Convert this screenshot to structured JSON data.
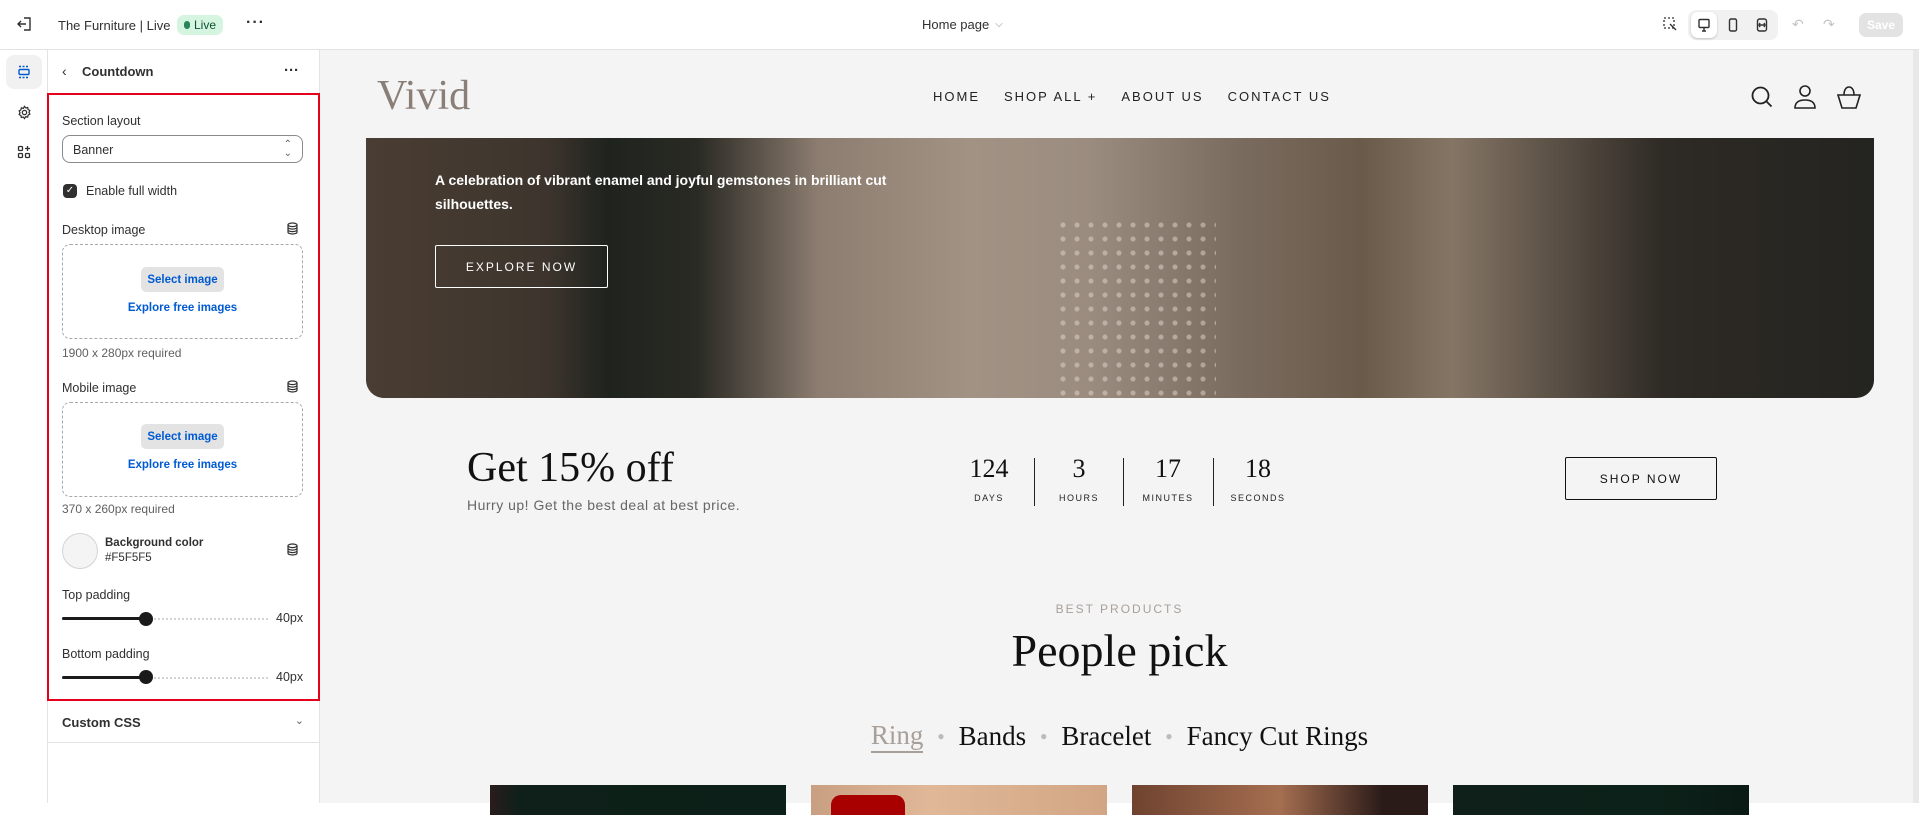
{
  "topbar": {
    "store_name": "The Furniture | Live",
    "status_badge": "Live",
    "page_selector": "Home page",
    "save_label": "Save"
  },
  "panel": {
    "title": "Countdown",
    "section_layout": {
      "label": "Section layout",
      "value": "Banner"
    },
    "full_width": {
      "label": "Enable full width",
      "checked": true
    },
    "desktop_image": {
      "label": "Desktop image",
      "select_label": "Select image",
      "explore_label": "Explore free images",
      "help": "1900 x 280px required"
    },
    "mobile_image": {
      "label": "Mobile image",
      "select_label": "Select image",
      "explore_label": "Explore free images",
      "help": "370 x 260px required"
    },
    "background_color": {
      "label": "Background color",
      "value": "#F5F5F5"
    },
    "top_padding": {
      "label": "Top padding",
      "value": "40px",
      "percent": 40
    },
    "bottom_padding": {
      "label": "Bottom padding",
      "value": "40px",
      "percent": 40
    },
    "custom_css": "Custom CSS"
  },
  "site": {
    "logo": "Vivid",
    "nav": [
      "HOME",
      "SHOP ALL +",
      "ABOUT US",
      "CONTACT US"
    ],
    "hero": {
      "text": "A celebration of vibrant enamel and joyful gemstones in brilliant cut silhouettes.",
      "button": "EXPLORE NOW"
    },
    "countdown": {
      "title": "Get 15% off",
      "subtitle": "Hurry up! Get the best deal at best price.",
      "units": [
        {
          "value": "124",
          "label": "DAYS"
        },
        {
          "value": "3",
          "label": "HOURS"
        },
        {
          "value": "17",
          "label": "MINUTES"
        },
        {
          "value": "18",
          "label": "SECONDS"
        }
      ],
      "button": "SHOP NOW"
    },
    "products": {
      "eyebrow": "BEST PRODUCTS",
      "title": "People pick",
      "tabs": [
        "Ring",
        "Bands",
        "Bracelet",
        "Fancy Cut Rings"
      ],
      "active_tab": "Ring"
    }
  },
  "colors": {
    "accent_blue": "#005bd3",
    "highlight_red": "#e5001b",
    "live_green": "#29845a",
    "preview_bg": "#F5F5F5"
  }
}
